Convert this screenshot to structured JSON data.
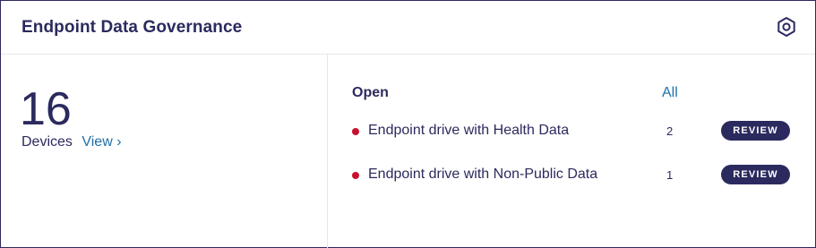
{
  "header": {
    "title": "Endpoint Data Governance",
    "settings_icon": "settings-hexagon-icon"
  },
  "summary": {
    "count": "16",
    "label": "Devices",
    "view_link": "View ›"
  },
  "open_section": {
    "title": "Open",
    "all_link": "All",
    "items": [
      {
        "label": "Endpoint drive with Health Data",
        "count": "2",
        "action": "REVIEW",
        "status_color": "#c8102e"
      },
      {
        "label": "Endpoint drive with Non-Public Data",
        "count": "1",
        "action": "REVIEW",
        "status_color": "#c8102e"
      }
    ]
  },
  "colors": {
    "primary": "#2b2a5e",
    "link": "#1e6fa8",
    "alert": "#c8102e"
  }
}
